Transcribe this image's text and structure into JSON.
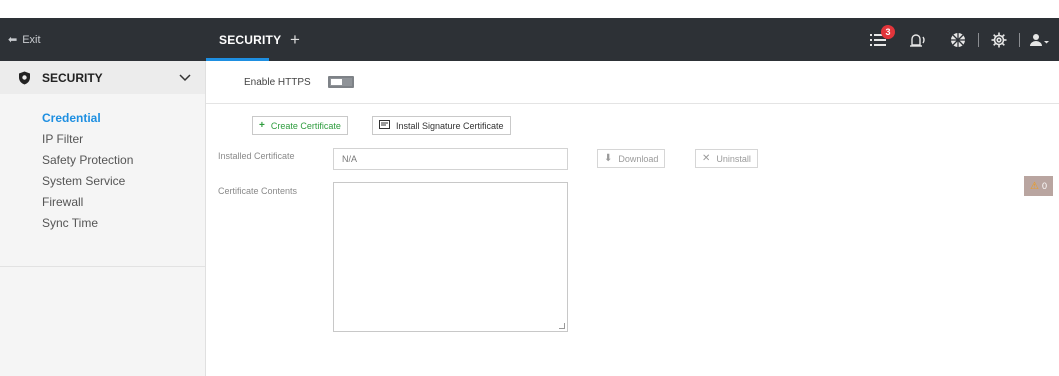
{
  "topbar": {
    "exit_label": "Exit",
    "tab_label": "SECURITY",
    "add_tab": "+",
    "notification_count": "3",
    "icons": [
      "list-icon",
      "alarm-light-icon",
      "network-icon",
      "gear-icon",
      "user-icon"
    ]
  },
  "sidebar": {
    "header": "SECURITY",
    "items": [
      {
        "label": "Credential",
        "active": true
      },
      {
        "label": "IP Filter"
      },
      {
        "label": "Safety Protection"
      },
      {
        "label": "System Service"
      },
      {
        "label": "Firewall"
      },
      {
        "label": "Sync Time"
      }
    ]
  },
  "main": {
    "https_label": "Enable HTTPS",
    "https_enabled": false,
    "create_certificate": "Create Certificate",
    "install_signature_certificate": "Install Signature Certificate",
    "installed_certificate_label": "Installed Certificate",
    "installed_certificate_value": "N/A",
    "download_label": "Download",
    "uninstall_label": "Uninstall",
    "certificate_contents_label": "Certificate Contents",
    "certificate_contents_value": ""
  },
  "alert": {
    "count": "0"
  },
  "colors": {
    "accent": "#1e8fe1",
    "topbar": "#2d3136",
    "create": "#2e9c3e",
    "badge": "#e2353b"
  }
}
